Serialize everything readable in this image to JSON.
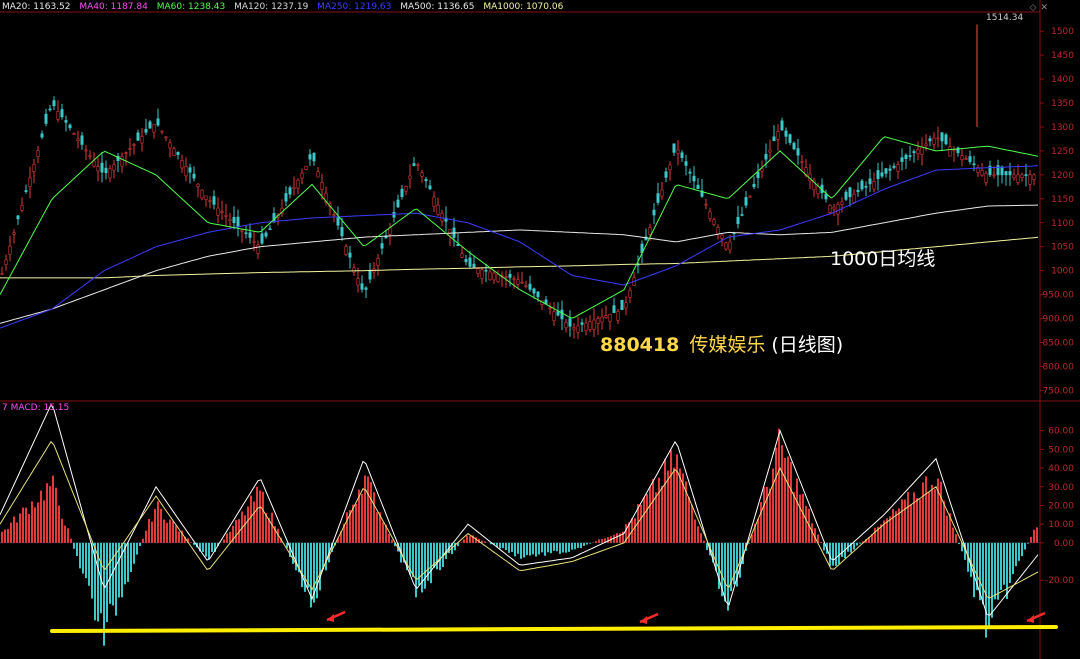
{
  "ma_legend": [
    {
      "label": "MA20: 1163.52",
      "color": "#e8e8e8"
    },
    {
      "label": "MA40: 1187.84",
      "color": "#ff4df5"
    },
    {
      "label": "MA60: 1238.43",
      "color": "#4dff4d"
    },
    {
      "label": "MA120: 1237.19",
      "color": "#d8d8d8"
    },
    {
      "label": "MA250: 1219.63",
      "color": "#3c3cff"
    },
    {
      "label": "MA500: 1136.65",
      "color": "#e8e8e8"
    },
    {
      "label": "MA1000: 1070.06",
      "color": "#f5f5a0"
    }
  ],
  "macd_legend": {
    "prefix": "7",
    "label": "MACD: 15.15",
    "color": "#ff4df5"
  },
  "annotations": {
    "ma1000": "1000日均线",
    "code": "880418",
    "name": "传媒娱乐",
    "kind": "(日线图)",
    "peak": "1514.34"
  },
  "colors": {
    "up": "#e03a3a",
    "down": "#3cc8c8",
    "axis": "#8a1010",
    "dif": "#ffffff",
    "dea": "#e8e07a",
    "support": "#ffee00"
  },
  "chart_data": [
    {
      "type": "line",
      "panel": "price",
      "ylim": [
        730,
        1540
      ],
      "yticks": [
        750,
        800,
        850,
        900,
        950,
        1000,
        1050,
        1100,
        1150,
        1200,
        1250,
        1300,
        1350,
        1400,
        1450,
        1500
      ],
      "ytick_labels": [
        "750.00",
        "800.00",
        "850.00",
        "900.00",
        "950.00",
        "1000",
        "1050",
        "1100",
        "1150",
        "1200",
        "1250",
        "1300",
        "1350",
        "1400",
        "1450",
        "1500"
      ],
      "x": [
        0,
        5,
        10,
        15,
        20,
        25,
        30,
        35,
        40,
        45,
        50,
        55,
        60,
        65,
        70,
        75,
        80,
        85,
        90,
        95,
        100
      ],
      "series": [
        {
          "name": "close",
          "color": "#e03a3a",
          "values": [
            980,
            1350,
            1200,
            1310,
            1150,
            1050,
            1240,
            950,
            1230,
            1010,
            980,
            880,
            920,
            1260,
            1050,
            1300,
            1130,
            1200,
            1280,
            1200,
            1200
          ]
        },
        {
          "name": "MA1000",
          "color": "#f5f5a0",
          "values": [
            985,
            985,
            985,
            990,
            993,
            996,
            998,
            1000,
            1003,
            1005,
            1008,
            1010,
            1013,
            1015,
            1020,
            1025,
            1030,
            1040,
            1050,
            1060,
            1070
          ]
        },
        {
          "name": "MA500",
          "color": "#e8e8e8",
          "values": [
            890,
            920,
            960,
            1000,
            1030,
            1050,
            1060,
            1070,
            1075,
            1080,
            1085,
            1080,
            1075,
            1060,
            1080,
            1075,
            1080,
            1100,
            1120,
            1135,
            1137
          ]
        },
        {
          "name": "MA250",
          "color": "#3c3cff",
          "values": [
            880,
            920,
            1000,
            1050,
            1080,
            1100,
            1110,
            1115,
            1120,
            1100,
            1060,
            990,
            970,
            1010,
            1070,
            1085,
            1120,
            1170,
            1210,
            1215,
            1219
          ]
        },
        {
          "name": "MA60",
          "color": "#4dff4d",
          "values": [
            950,
            1150,
            1250,
            1200,
            1100,
            1080,
            1180,
            1050,
            1130,
            1040,
            960,
            900,
            960,
            1180,
            1150,
            1250,
            1150,
            1280,
            1250,
            1260,
            1238
          ]
        }
      ],
      "annotations": [
        "1514.34",
        "1000日均线",
        "880418 传媒娱乐 (日线图)"
      ]
    },
    {
      "type": "bar",
      "panel": "macd",
      "ylim": [
        -60,
        70
      ],
      "yticks": [
        -20,
        0,
        10,
        20,
        30,
        40,
        50,
        60
      ],
      "ytick_labels": [
        "-20.00",
        "0.00",
        "10.00",
        "20.00",
        "30.00",
        "40.00",
        "50.00",
        "60.00"
      ],
      "x": [
        0,
        5,
        10,
        15,
        20,
        25,
        30,
        35,
        40,
        45,
        50,
        55,
        60,
        65,
        70,
        75,
        80,
        85,
        90,
        95,
        100
      ],
      "series": [
        {
          "name": "MACD",
          "color": "#e03a3a",
          "values": [
            5,
            35,
            -55,
            22,
            -10,
            30,
            -35,
            40,
            -30,
            5,
            -8,
            -5,
            8,
            50,
            -40,
            58,
            -15,
            12,
            40,
            -52,
            15
          ]
        },
        {
          "name": "DIF",
          "color": "#ffffff",
          "values": [
            15,
            75,
            -25,
            30,
            -10,
            35,
            -30,
            45,
            -25,
            10,
            -12,
            -8,
            5,
            55,
            -35,
            60,
            -10,
            15,
            45,
            -40,
            -5
          ]
        },
        {
          "name": "DEA",
          "color": "#e8e07a",
          "values": [
            10,
            55,
            -15,
            25,
            -15,
            20,
            -25,
            30,
            -20,
            5,
            -15,
            -10,
            0,
            40,
            -25,
            40,
            -15,
            10,
            30,
            -30,
            -15
          ]
        }
      ],
      "annotations": [
        "support-line"
      ]
    }
  ]
}
